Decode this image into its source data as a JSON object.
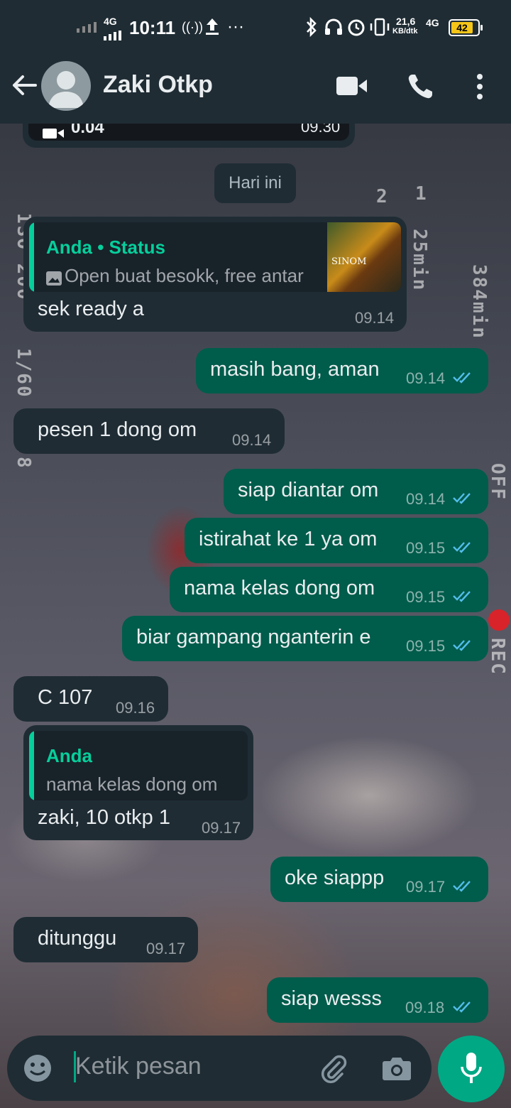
{
  "status_bar": {
    "time": "10:11",
    "network_left": "4G",
    "speed_value": "21,6",
    "speed_unit": "KB/dtk",
    "network_right": "4G",
    "battery": "42"
  },
  "header": {
    "contact_name": "Zaki Otkp"
  },
  "top_cut_bubble": {
    "video_duration": "0.04",
    "time": "09.30"
  },
  "date_chip": "Hari ini",
  "messages": [
    {
      "dir": "in",
      "quote_author": "Anda • Status",
      "quote_text": "Open buat besokk, free antar",
      "thumb_label": "SINOM",
      "text": "sek ready a",
      "time": "09.14"
    },
    {
      "dir": "out",
      "text": "masih bang, aman",
      "time": "09.14"
    },
    {
      "dir": "in",
      "text": "pesen 1 dong om",
      "time": "09.14"
    },
    {
      "dir": "out",
      "text": "siap diantar om",
      "time": "09.14"
    },
    {
      "dir": "out",
      "text": "istirahat ke 1 ya om",
      "time": "09.15"
    },
    {
      "dir": "out",
      "text": "nama kelas dong om",
      "time": "09.15"
    },
    {
      "dir": "out",
      "text": "biar gampang nganterin e",
      "time": "09.15"
    },
    {
      "dir": "in",
      "text": "C 107",
      "time": "09.16"
    },
    {
      "dir": "in",
      "quote_author": "Anda",
      "quote_text": "nama kelas dong om",
      "text": "zaki, 10 otkp 1",
      "time": "09.17"
    },
    {
      "dir": "out",
      "text": "oke siappp",
      "time": "09.17"
    },
    {
      "dir": "in",
      "text": "ditunggu",
      "time": "09.17"
    },
    {
      "dir": "out",
      "text": "siap wesss",
      "time": "09.18"
    }
  ],
  "wallpaper_overlay": {
    "iso": "ISO 200",
    "shutter": "1/60",
    "aperture": "F2.8",
    "rec": "REC",
    "minutes_25": "25min",
    "minutes_384": "384min",
    "off": "OFF",
    "num_1": "1",
    "num_2": "2"
  },
  "composer": {
    "placeholder": "Ketik pesan"
  },
  "colors": {
    "header_bg": "#1f2c34",
    "incoming_bubble": "#1f2c34",
    "outgoing_bubble": "#005c4b",
    "accent": "#00a884",
    "read_ticks": "#53bdeb"
  }
}
